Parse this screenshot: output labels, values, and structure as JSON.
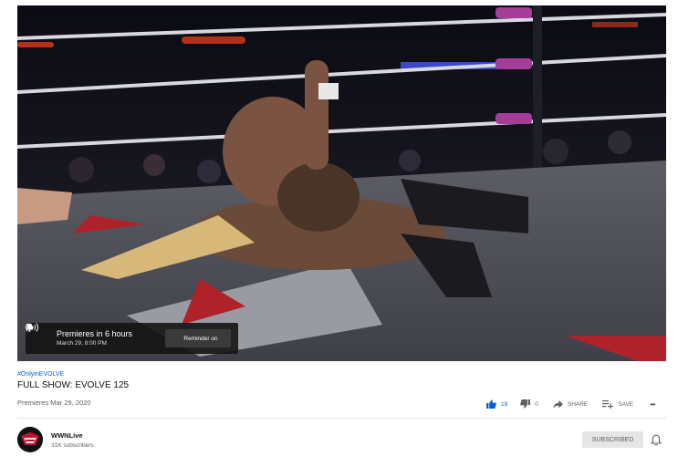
{
  "player": {
    "premiere_title": "Premieres in 6 hours",
    "premiere_date": "March 29, 8:00 PM",
    "reminder_label": "Reminder on"
  },
  "video": {
    "hashtag": "#OnlyinEVOLVE",
    "title": "FULL SHOW: EVOLVE 125",
    "premiere_date": "Premieres Mar 29, 2020"
  },
  "actions": {
    "likes": "19",
    "dislikes": "0",
    "share_label": "SHARE",
    "save_label": "SAVE",
    "more_label": "•••"
  },
  "channel": {
    "name": "WWNLive",
    "subscribers": "31K subscribers",
    "subscribed_label": "SUBSCRIBED"
  },
  "colors": {
    "link_blue": "#065fd4",
    "text_secondary": "#606060",
    "subscribed_bg": "#e6e6e6"
  }
}
